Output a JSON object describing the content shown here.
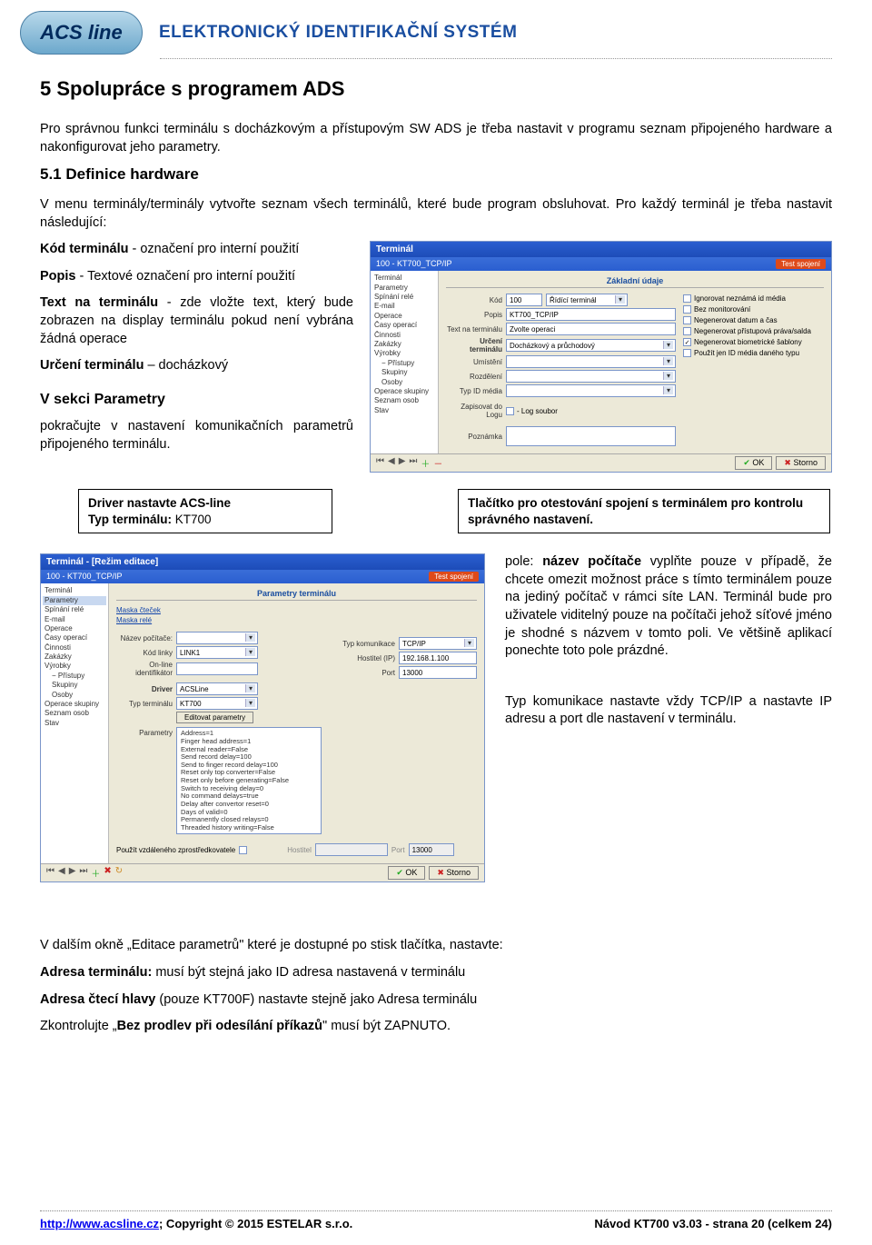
{
  "header": {
    "logo_text": "ACS line",
    "title": "ELEKTRONICKÝ IDENTIFIKAČNÍ SYSTÉM"
  },
  "doc": {
    "h1": "5  Spolupráce s programem ADS",
    "intro": "Pro správnou funkci terminálu s docházkovým a přístupovým SW ADS je třeba nastavit v programu seznam připojeného hardware a nakonfigurovat jeho parametry.",
    "h2": "5.1  Definice hardware",
    "p1": "V menu terminály/terminály vytvořte seznam všech terminálů, které bude program obsluhovat. Pro každý terminál je třeba nastavit následující:",
    "kod_lbl": "Kód terminálu",
    "kod_txt": " - označení pro interní použití",
    "popis_lbl": "Popis",
    "popis_txt": " - Textové označení pro interní použití",
    "textna_lbl": "Text na terminálu",
    "textna_txt": " - zde vložte text, který bude zobrazen na display terminálu pokud není vybrána žádná operace",
    "urceni_lbl": "Určení terminálu",
    "urceni_txt": " – docházkový",
    "sek_h": "V sekci Parametry",
    "sek_p": "pokračujte v nastavení komunikačních parametrů připojeného terminálu.",
    "note_left_1": "Driver nastavte ACS-line",
    "note_left_2": "Typ terminálu: ",
    "note_left_2v": "KT700",
    "note_right_1": "Tlačítko pro otestování spojení s terminálem pro kontrolu správného nastavení.",
    "callout1": "pole: název počítače vyplňte pouze v případě, že chcete omezit možnost práce s tímto terminálem pouze na jediný počítač v rámci síte LAN. Terminál bude pro uživatele viditelný pouze na počítači jehož síťové jméno je shodné s názvem v tomto poli. Ve většině aplikací ponechte toto pole prázdné.",
    "callout2": "Typ komunikace nastavte vždy TCP/IP a nastavte IP adresu a port dle nastavení v terminálu.",
    "bottom1": "V dalším okně „Editace parametrů\" které je dostupné po stisk tlačítka, nastavte:",
    "bottom2a": "Adresa terminálu:",
    "bottom2b": " musí být stejná jako ID adresa nastavená v terminálu",
    "bottom3a": "Adresa čtecí hlavy",
    "bottom3b": " (pouze KT700F) nastavte stejně jako Adresa terminálu",
    "bottom4a": "Zkontrolujte „",
    "bottom4b": "Bez prodlev při odesílání příkazů",
    "bottom4c": "\" musí být ZAPNUTO."
  },
  "win1": {
    "title": "Terminál",
    "sub_left": "100  -  KT700_TCP/IP",
    "test": "Test spojení",
    "tree": [
      "Terminál",
      "Parametry",
      "Spínání relé",
      "E-mail",
      "Operace",
      "Časy operací",
      "Činnosti",
      "Zakázky",
      "Výrobky",
      "Přístupy",
      "Skupiny",
      "Osoby",
      "Operace skupiny",
      "Seznam osob",
      "Stav"
    ],
    "panel_title": "Základní údaje",
    "labels": {
      "kod": "Kód",
      "popis": "Popis",
      "textna": "Text na terminálu",
      "urceni": "Určení terminálu",
      "umisteni": "Umístění",
      "rozdeleni": "Rozdělení",
      "typid": "Typ ID média",
      "zap": "Zapisovat do Logu",
      "ridici": "Řídící terminál",
      "pozn": "Poznámka"
    },
    "values": {
      "kod": "100",
      "popis": "KT700_TCP/IP",
      "textna": "Zvolte operaci",
      "urceni": "Docházkový a průchodový"
    },
    "checks": [
      "Ignorovat neznámá id média",
      "Bez monitorování",
      "Negenerovat datum a čas",
      "Negenerovat přístupová práva/salda",
      "Negenerovat biometrické šablony",
      "Použít jen ID média daného typu"
    ],
    "log_chk": " - Log soubor",
    "ok": "OK",
    "storno": "Storno"
  },
  "win2": {
    "title": "Terminál - [Režim editace]",
    "sub_left": "100  -  KT700_TCP/IP",
    "test": "Test spojení",
    "tree": [
      "Terminál",
      "Parametry",
      "Spínání relé",
      "E-mail",
      "Operace",
      "Časy operací",
      "Činnosti",
      "Zakázky",
      "Výrobky",
      "Přístupy",
      "Skupiny",
      "Osoby",
      "Operace skupiny",
      "Seznam osob",
      "Stav"
    ],
    "tree_sel_idx": 1,
    "panel_title": "Parametry terminálu",
    "labels": {
      "maska_c": "Maska čteček",
      "maska_r": "Maska relé",
      "nazev": "Název počítače:",
      "kodl": "Kód linky",
      "online": "On-line identifikátor",
      "driver": "Driver",
      "typ": "Typ terminálu",
      "editp": "Editovat parametry",
      "typk": "Typ komunikace",
      "host": "Hostitel (IP)",
      "port": "Port",
      "param": "Parametry",
      "zpr": "Použít vzdáleného zprostředkovatele",
      "host2": "Hostitel",
      "port2": "Port"
    },
    "values": {
      "kodl": "LINK1",
      "driver": "ACSLine",
      "typ": "KT700",
      "typk": "TCP/IP",
      "host": "192.168.1.100",
      "port": "13000",
      "port2": "13000"
    },
    "params_text": "Address=1\nFinger head address=1\nExternal reader=False\nSend record delay=100\nSend to finger record delay=100\nReset only top converter=False\nReset only before generating=False\nSwitch to receiving delay=0\nNo command delays=true\nDelay after convertor reset=0\nDays of valid=0\nPermanently closed relays=0\nThreaded history writing=False",
    "ok": "OK",
    "storno": "Storno"
  },
  "footer": {
    "left_url": "http://www.acsline.cz",
    "left_rest": "; Copyright © 2015 ESTELAR s.r.o.",
    "right": "Návod KT700 v3.03 - strana 20 (celkem 24)"
  }
}
